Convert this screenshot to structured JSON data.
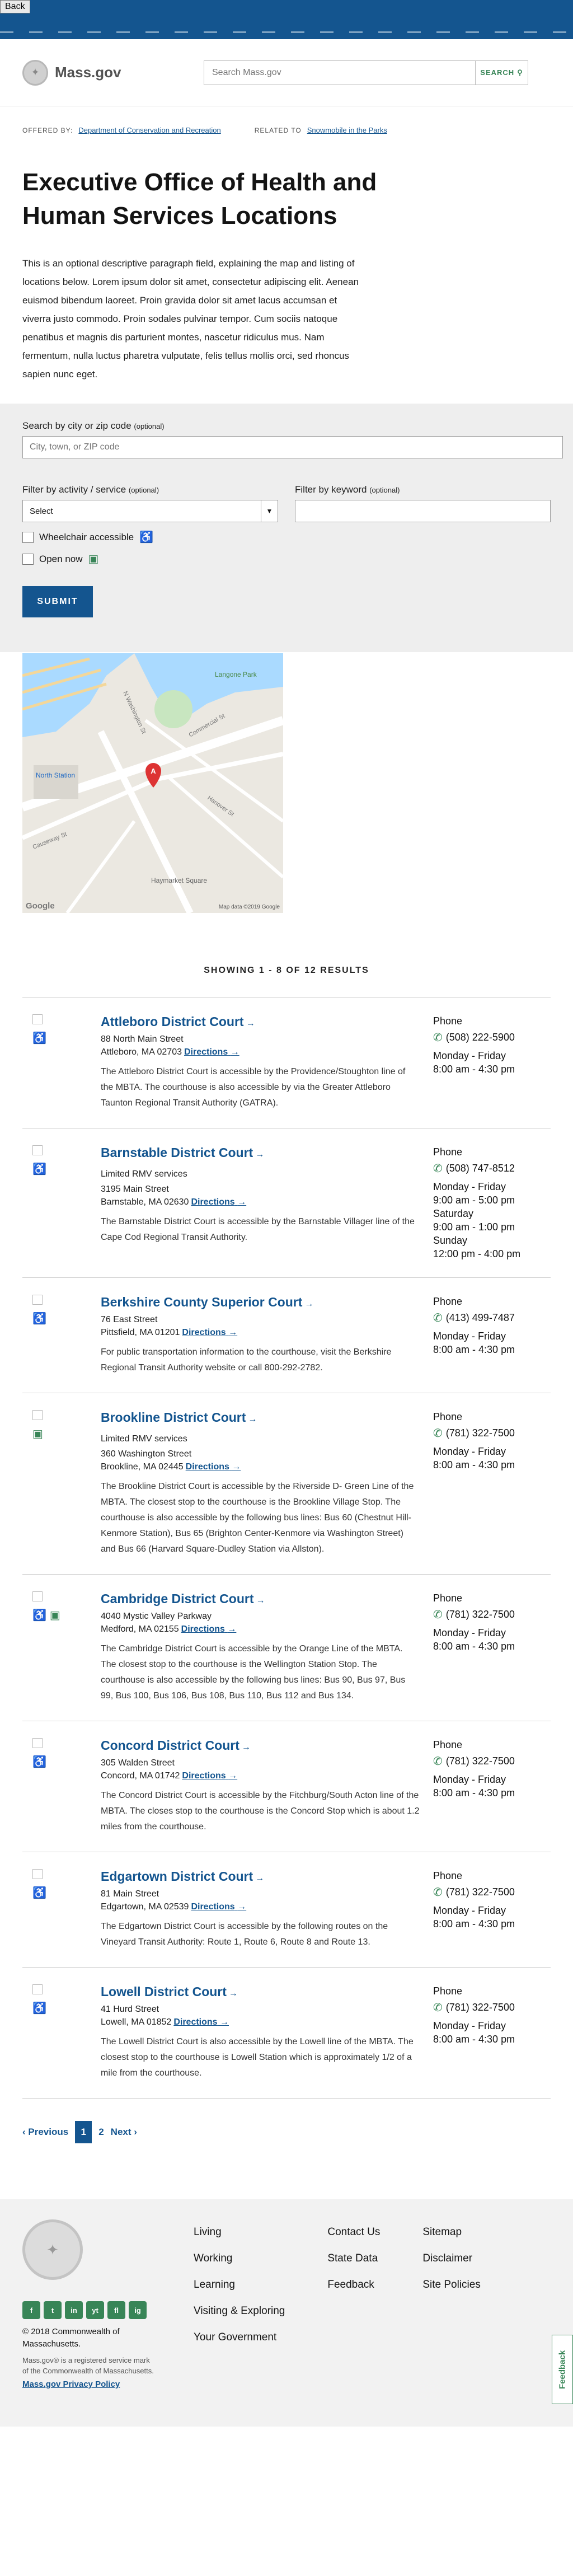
{
  "browser": {
    "back_label": "Back"
  },
  "header": {
    "logo_text": "Mass.gov",
    "search_placeholder": "Search Mass.gov",
    "search_button": "SEARCH"
  },
  "meta": {
    "offered_by_label": "OFFERED BY:",
    "offered_by_value": "Department of Conservation and Recreation",
    "related_label": "RELATED TO",
    "related_value": "Snowmobile in the Parks"
  },
  "page": {
    "title": "Executive Office of Health and Human Services Locations",
    "intro": "This is an optional descriptive paragraph field, explaining the map and listing of locations below. Lorem ipsum dolor sit amet, consectetur adipiscing elit. Aenean euismod bibendum laoreet. Proin gravida dolor sit amet lacus accumsan et viverra justo commodo. Proin sodales pulvinar tempor. Cum sociis natoque penatibus et magnis dis parturient montes, nascetur ridiculus mus. Nam fermentum, nulla luctus pharetra vulputate, felis tellus mollis orci, sed rhoncus sapien nunc eget."
  },
  "filters": {
    "location_label": "Search by city or zip code",
    "location_optional": "(optional)",
    "location_placeholder": "City, town, or ZIP code",
    "activity_label": "Filter by activity / service",
    "activity_optional": "(optional)",
    "activity_value": "Select",
    "keyword_label": "Filter by keyword",
    "keyword_optional": "(optional)",
    "wheelchair_label": "Wheelchair accessible",
    "open_label": "Open now",
    "submit_label": "SUBMIT"
  },
  "map": {
    "labels": {
      "langone": "Langone Park",
      "north_station": "North Station",
      "haymarket": "Haymarket Square",
      "causeway": "Causeway St",
      "washington": "N Washington St",
      "commercial": "Commercial St",
      "hanover": "Hanover St",
      "google": "Google",
      "map_data": "Map data ©2019 Google"
    },
    "pin_label": "A"
  },
  "results": {
    "count_text": "SHOWING 1 - 8 OF 12 RESULTS"
  },
  "locations": [
    {
      "name": "Attleboro District Court",
      "tag": "",
      "street": "88 North Main Street",
      "city": "Attleboro, MA 02703",
      "directions": "Directions",
      "desc": "The Attleboro District Court is accessible by the Providence/Stoughton line of the MBTA. The courthouse is also accessible by via the Greater Attleboro Taunton Regional Transit Authority (GATRA).",
      "phone": "(508) 222-5900",
      "hours": [
        "Monday - Friday",
        "8:00 am - 4:30 pm"
      ],
      "wheelchair": true,
      "open": false
    },
    {
      "name": "Barnstable District Court",
      "tag": "Limited RMV services",
      "street": "3195 Main Street",
      "city": "Barnstable, MA 02630",
      "directions": "Directions",
      "desc": "The Barnstable District Court is accessible by the Barnstable Villager line of the Cape Cod Regional Transit Authority.",
      "phone": "(508) 747-8512",
      "hours": [
        "Monday - Friday",
        "9:00 am - 5:00 pm",
        "Saturday",
        "9:00 am - 1:00 pm",
        "Sunday",
        "12:00 pm - 4:00 pm"
      ],
      "wheelchair": true,
      "open": false
    },
    {
      "name": "Berkshire County Superior Court",
      "tag": "",
      "street": "76 East Street",
      "city": "Pittsfield, MA 01201",
      "directions": "Directions",
      "desc": "For public transportation information to the courthouse, visit the Berkshire Regional Transit Authority website or call 800-292-2782.",
      "phone": "(413) 499-7487",
      "hours": [
        "Monday - Friday",
        "8:00 am - 4:30 pm"
      ],
      "wheelchair": true,
      "open": false
    },
    {
      "name": "Brookline District Court",
      "tag": "Limited RMV services",
      "street": "360 Washington Street",
      "city": "Brookline, MA 02445",
      "directions": "Directions",
      "desc": "The Brookline District Court is accessible by the Riverside D- Green Line of the MBTA. The closest stop to the courthouse is the Brookline Village Stop. The courthouse is also accessible by the following bus lines: Bus 60 (Chestnut Hill-Kenmore Station), Bus 65 (Brighton Center-Kenmore via Washington Street) and Bus 66 (Harvard Square-Dudley Station via Allston).",
      "phone": "(781) 322-7500",
      "hours": [
        "Monday - Friday",
        "8:00 am - 4:30 pm"
      ],
      "wheelchair": false,
      "open": true
    },
    {
      "name": "Cambridge District Court",
      "tag": "",
      "street": "4040 Mystic Valley Parkway",
      "city": "Medford, MA 02155",
      "directions": "Directions",
      "desc": "The Cambridge District Court is accessible by the Orange Line of the MBTA. The closest stop to the courthouse is the Wellington Station Stop. The courthouse is also accessible by the following bus lines: Bus 90, Bus 97, Bus 99, Bus 100, Bus 106, Bus 108, Bus 110, Bus 112 and Bus 134.",
      "phone": "(781) 322-7500",
      "hours": [
        "Monday - Friday",
        "8:00 am - 4:30 pm"
      ],
      "wheelchair": true,
      "open": true
    },
    {
      "name": "Concord District Court",
      "tag": "",
      "street": "305 Walden Street",
      "city": "Concord, MA 01742",
      "directions": "Directions",
      "desc": "The Concord District Court is accessible by the Fitchburg/South Acton line of the MBTA. The closes stop to the courthouse is the Concord Stop which is about 1.2 miles from the courthouse.",
      "phone": "(781) 322-7500",
      "hours": [
        "Monday - Friday",
        "8:00 am - 4:30 pm"
      ],
      "wheelchair": true,
      "open": false
    },
    {
      "name": "Edgartown District Court",
      "tag": "",
      "street": "81 Main Street",
      "city": "Edgartown, MA 02539",
      "directions": "Directions",
      "desc": "The Edgartown District Court is accessible by the following routes on the Vineyard Transit Authority: Route 1, Route 6, Route 8 and Route 13.",
      "phone": "(781) 322-7500",
      "hours": [
        "Monday - Friday",
        "8:00 am - 4:30 pm"
      ],
      "wheelchair": true,
      "open": false
    },
    {
      "name": "Lowell District Court",
      "tag": "",
      "street": "41 Hurd Street",
      "city": "Lowell, MA 01852",
      "directions": "Directions",
      "desc": "The Lowell District Court is also accessible by the Lowell line of the MBTA. The closest stop to the courthouse is Lowell Station which is approximately 1/2 of a mile from the courthouse.",
      "phone": "(781) 322-7500",
      "hours": [
        "Monday - Friday",
        "8:00 am - 4:30 pm"
      ],
      "wheelchair": true,
      "open": false
    }
  ],
  "phone_label": "Phone",
  "pager": {
    "prev": "Previous",
    "pages": [
      "1",
      "2"
    ],
    "next": "Next"
  },
  "footer": {
    "cols": [
      [
        "Living",
        "Working",
        "Learning",
        "Visiting & Exploring",
        "Your Government"
      ],
      [
        "Contact Us",
        "State Data",
        "Feedback"
      ],
      [
        "Sitemap",
        "Disclaimer",
        "Site Policies"
      ]
    ],
    "social": [
      "f",
      "t",
      "in",
      "yt",
      "fl",
      "ig"
    ],
    "copyright": "© 2018 Commonwealth of Massachusetts.",
    "trademark": "Mass.gov® is a registered service mark of the Commonwealth of Massachusetts.",
    "privacy": "Mass.gov Privacy Policy",
    "feedback_tab": "Feedback"
  }
}
